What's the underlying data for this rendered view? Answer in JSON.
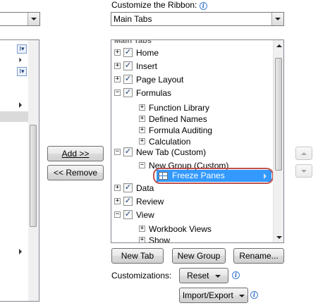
{
  "right_panel": {
    "customize_label": "Customize the Ribbon:",
    "ribbon_select": "Main Tabs",
    "tree_header": "Main Tabs",
    "tree": [
      {
        "label": "Home",
        "level": 0,
        "expander": "+",
        "checked": true
      },
      {
        "label": "Insert",
        "level": 0,
        "expander": "+",
        "checked": true
      },
      {
        "label": "Page Layout",
        "level": 0,
        "expander": "+",
        "checked": true
      },
      {
        "label": "Formulas",
        "level": 0,
        "expander": "−",
        "checked": true
      },
      {
        "label": "Function Library",
        "level": 1,
        "expander": "+"
      },
      {
        "label": "Defined Names",
        "level": 1,
        "expander": "+"
      },
      {
        "label": "Formula Auditing",
        "level": 1,
        "expander": "+"
      },
      {
        "label": "Calculation",
        "level": 1,
        "expander": "+"
      },
      {
        "label": "New Tab (Custom)",
        "level": 0,
        "expander": "−",
        "checked": true
      },
      {
        "label": "New Group (Custom)",
        "level": 1,
        "expander": "−"
      },
      {
        "label": "Freeze Panes",
        "level": 2,
        "selected": true
      },
      {
        "label": "Data",
        "level": 0,
        "expander": "+",
        "checked": true
      },
      {
        "label": "Review",
        "level": 0,
        "expander": "+",
        "checked": true
      },
      {
        "label": "View",
        "level": 0,
        "expander": "−",
        "checked": true
      },
      {
        "label": "Workbook Views",
        "level": 1,
        "expander": "+"
      },
      {
        "label": "Show",
        "level": 1,
        "expander": "+"
      }
    ],
    "buttons": {
      "new_tab": "New Tab",
      "new_group": "New Group",
      "rename": "Rename..."
    },
    "customizations_label": "Customizations:",
    "reset_label": "Reset",
    "import_export_label": "Import/Export"
  },
  "middle": {
    "add_label": "Add >>",
    "remove_label": "<< Remove"
  },
  "icons": {
    "info": "info-icon",
    "dropdown": "chevron-down-icon",
    "move_up": "arrow-up-icon",
    "move_down": "arrow-down-icon",
    "selected_item": "freeze-panes-icon",
    "submenu": "chevron-right-icon"
  },
  "colors": {
    "selection": "#3399ff",
    "annotation_ring": "#c0504d",
    "info_blue": "#3a7bd5"
  }
}
